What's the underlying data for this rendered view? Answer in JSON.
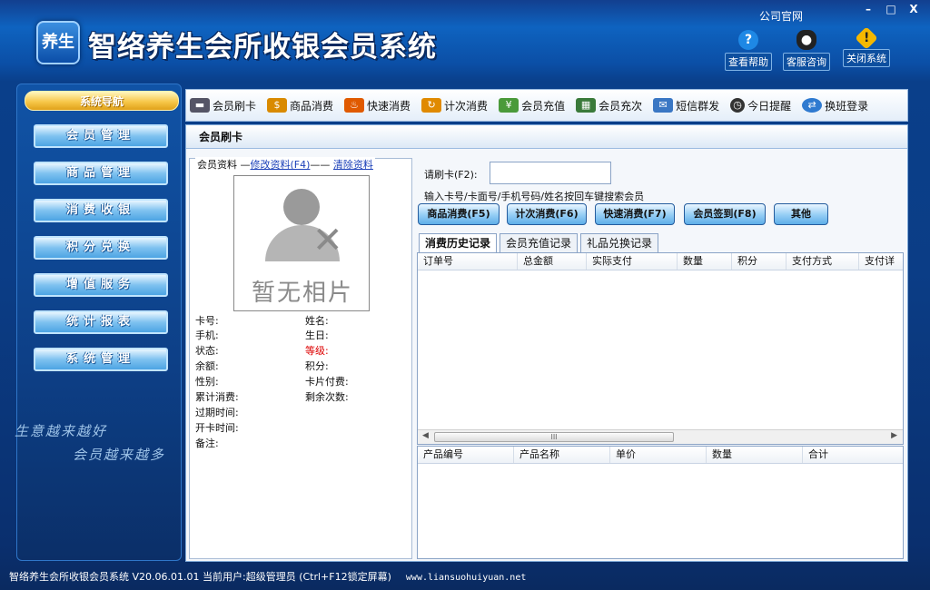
{
  "app": {
    "logo_text": "养生",
    "title": "智络养生会所收银会员系统",
    "company_link": "公司官网"
  },
  "window_controls": [
    "–",
    "□",
    "X"
  ],
  "header_actions": [
    {
      "label": "查看帮助",
      "icon": "help-icon",
      "color": "#1e88e5"
    },
    {
      "label": "客服咨询",
      "icon": "qq-penguin-icon",
      "color": "#222222"
    },
    {
      "label": "关闭系统",
      "icon": "warning-icon",
      "color": "#f5b800"
    }
  ],
  "sidebar": {
    "title": "系统导航",
    "items": [
      "会员管理",
      "商品管理",
      "消费收银",
      "积分兑换",
      "增值服务",
      "统计报表",
      "系统管理"
    ],
    "slogan_line1": "生意越来越好",
    "slogan_line2": "会员越来越多"
  },
  "toolbar": [
    {
      "label": "会员刷卡",
      "icon": "card-reader-icon",
      "color": "#556"
    },
    {
      "label": "商品消费",
      "icon": "money-bag-icon",
      "color": "#d98a00"
    },
    {
      "label": "快速消费",
      "icon": "flame-icon",
      "color": "#e05a00"
    },
    {
      "label": "计次消费",
      "icon": "refresh-icon",
      "color": "#e08a00"
    },
    {
      "label": "会员充值",
      "icon": "recharge-icon",
      "color": "#4a9a3a"
    },
    {
      "label": "会员充次",
      "icon": "calendar-icon",
      "color": "#3a7a3a"
    },
    {
      "label": "短信群发",
      "icon": "envelope-icon",
      "color": "#3a77c4"
    },
    {
      "label": "今日提醒",
      "icon": "clock-icon",
      "color": "#333"
    },
    {
      "label": "换班登录",
      "icon": "switch-user-icon",
      "color": "#2f7ad0"
    }
  ],
  "main": {
    "title": "会员刷卡",
    "member_panel": {
      "legend": "会员资料",
      "edit_link": "修改资料(F4)",
      "clear_link": "清除资料",
      "photo_text": "暂无相片",
      "fields_left": [
        "卡号:",
        "手机:",
        "状态:",
        "余额:",
        "性别:",
        "累计消费:",
        "过期时间:",
        "开卡时间:",
        "备注:"
      ],
      "fields_right": [
        "姓名:",
        "生日:",
        "等级:",
        "积分:",
        "卡片付费:",
        "剩余次数:"
      ]
    },
    "swipe": {
      "label": "请刷卡(F2):",
      "value": "",
      "hint": "输入卡号/卡面号/手机号码/姓名按回车键搜索会员"
    },
    "actions": [
      "商品消费(F5)",
      "计次消费(F6)",
      "快速消费(F7)",
      "会员签到(F8)",
      "其他"
    ],
    "tabs": [
      "消费历史记录",
      "会员充值记录",
      "礼品兑换记录"
    ],
    "active_tab": 0,
    "history_columns": [
      "订单号",
      "总金额",
      "实际支付",
      "数量",
      "积分",
      "支付方式",
      "支付详"
    ],
    "scroll_thumb": "III",
    "detail_columns": [
      "产品编号",
      "产品名称",
      "单价",
      "数量",
      "合计"
    ]
  },
  "status_bar": {
    "text": "智络养生会所收银会员系统 V20.06.01.01 当前用户:超级管理员 (Ctrl+F12锁定屏幕)",
    "url": "www.liansuohuiyuan.net"
  }
}
